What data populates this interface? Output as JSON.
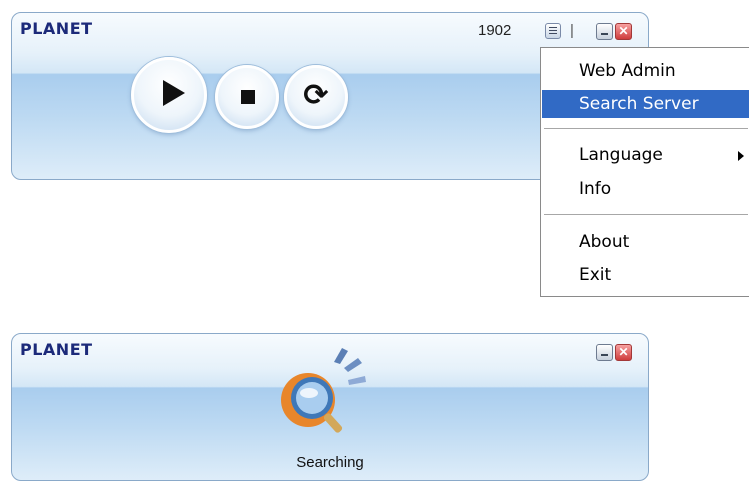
{
  "main_window": {
    "logo": "PLANET",
    "port": "1902",
    "separator": "|",
    "close_glyph": "✕",
    "controls": {
      "play_icon": "play-icon",
      "stop_icon": "stop-icon",
      "refresh_icon": "refresh-icon",
      "refresh_glyph": "⟳"
    }
  },
  "context_menu": {
    "items": [
      {
        "label": "Web Admin"
      },
      {
        "label": "Search Server",
        "highlighted": true
      },
      {
        "label": "Language",
        "has_submenu": true
      },
      {
        "label": "Info"
      },
      {
        "label": "About"
      },
      {
        "label": "Exit"
      }
    ],
    "highlight_color": "#316ac5"
  },
  "search_window": {
    "logo": "PLANET",
    "close_glyph": "✕",
    "status_text": "Searching"
  },
  "colors": {
    "logo": "#1c2a7a",
    "panel_border": "#8aa9c9",
    "close_button": "#cf3c3c"
  }
}
